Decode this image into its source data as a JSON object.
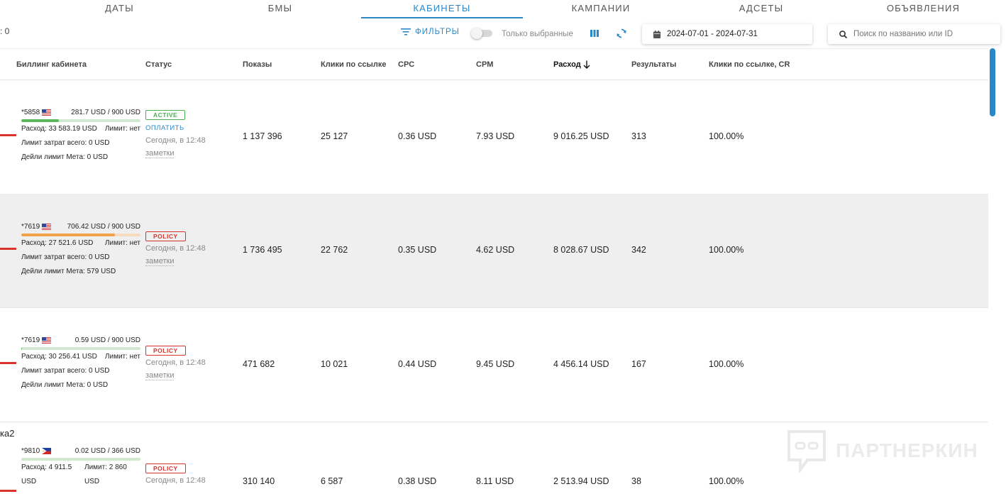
{
  "tabs": [
    {
      "label": "ДАТЫ"
    },
    {
      "label": "БМЫ"
    },
    {
      "label": "КАБИНЕТЫ"
    },
    {
      "label": "КАМПАНИИ"
    },
    {
      "label": "АДСЕТЫ"
    },
    {
      "label": "ОБЪЯВЛЕНИЯ"
    }
  ],
  "active_tab": "КАБИНЕТЫ",
  "count_label": ": 0",
  "toolbar": {
    "filters_label": "ФИЛЬТРЫ",
    "only_selected_label": "Только выбранные",
    "only_selected_on": false,
    "date_range": "2024-07-01 - 2024-07-31",
    "search_placeholder": "Поиск по названию или ID"
  },
  "columns": {
    "billing": "Биллинг кабинета",
    "status": "Статус",
    "impressions": "Показы",
    "link_clicks": "Клики по ссылке",
    "cpc": "CPC",
    "cpm": "CPM",
    "spend": "Расход",
    "results": "Результаты",
    "cr": "Клики по ссылке, CR"
  },
  "rows": [
    {
      "account": "*5858",
      "flag": "us-flag-icon",
      "balance": "281.7 USD / 900 USD",
      "balance_fraction": 0.313,
      "bar_color": "green",
      "spend_line": "Расход: 33 583.19 USD",
      "limit_line": "Лимит: нет",
      "total_limit": "Лимит затрат всего: 0 USD",
      "daily_limit": "Дейли лимит Мета: 0 USD",
      "status": "ACTIVE",
      "pay_link": "ОПЛАТИТЬ",
      "time": "Сегодня, в 12:48",
      "notes": "заметки",
      "impressions": "1 137 396",
      "link_clicks": "25 127",
      "cpc": "0.36 USD",
      "cpm": "7.93 USD",
      "spend": "9 016.25 USD",
      "results": "313",
      "cr": "100.00%"
    },
    {
      "account": "*7619",
      "flag": "us-flag-icon",
      "balance": "706.42 USD / 900 USD",
      "balance_fraction": 0.785,
      "bar_color": "orange",
      "spend_line": "Расход: 27 521.6 USD",
      "limit_line": "Лимит: нет",
      "total_limit": "Лимит затрат всего: 0 USD",
      "daily_limit": "Дейли лимит Мета: 579 USD",
      "status": "POLICY",
      "pay_link": "",
      "time": "Сегодня, в 12:48",
      "notes": "заметки",
      "impressions": "1 736 495",
      "link_clicks": "22 762",
      "cpc": "0.35 USD",
      "cpm": "4.62 USD",
      "spend": "8 028.67 USD",
      "results": "342",
      "cr": "100.00%"
    },
    {
      "account": "*7619",
      "flag": "us-flag-icon",
      "balance": "0.59 USD / 900 USD",
      "balance_fraction": 0.001,
      "bar_color": "green",
      "spend_line": "Расход: 30 256.41 USD",
      "limit_line": "Лимит: нет",
      "total_limit": "Лимит затрат всего: 0 USD",
      "daily_limit": "Дейли лимит Мета: 0 USD",
      "status": "POLICY",
      "pay_link": "",
      "time": "Сегодня, в 12:48",
      "notes": "заметки",
      "impressions": "471 682",
      "link_clicks": "10 021",
      "cpc": "0.44 USD",
      "cpm": "9.45 USD",
      "spend": "4 456.14 USD",
      "results": "167",
      "cr": "100.00%"
    },
    {
      "account": "*9810",
      "flag": "ph-flag-icon",
      "balance": "0.02 USD / 366 USD",
      "balance_fraction": 0.0,
      "bar_color": "green",
      "spend_line": "Расход: 4 911.5",
      "limit_line": "Лимит: 2 860",
      "spend_line_cont": "USD",
      "limit_line_cont": "USD",
      "status": "POLICY",
      "pay_link": "",
      "time": "Сегодня, в 12:48",
      "notes": "",
      "impressions": "310 140",
      "link_clicks": "6 587",
      "cpc": "0.38 USD",
      "cpm": "8.11 USD",
      "spend": "2 513.94 USD",
      "results": "38",
      "cr": "100.00%"
    }
  ],
  "row4_label_fragment": "ка2",
  "watermark": "ПАРТНЕРКИН",
  "colors": {
    "accent": "#2a88c9",
    "active": "#4caf50",
    "policy": "#d9342b",
    "bar_green": "#5cb85c",
    "bar_orange": "#f0a14a"
  }
}
